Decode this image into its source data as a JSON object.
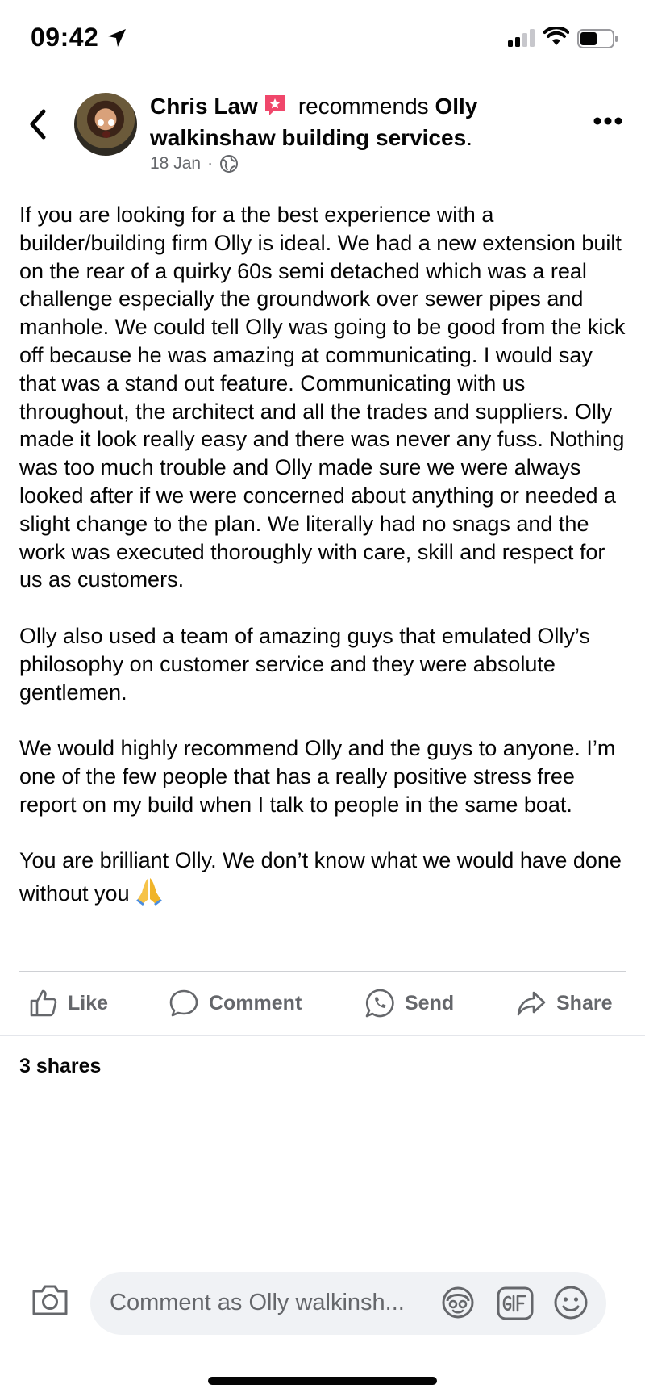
{
  "status_bar": {
    "time": "09:42"
  },
  "header": {
    "author": "Chris Law",
    "verb": "recommends",
    "page_name": "Olly walkinshaw building services",
    "punct": ".",
    "date": "18 Jan",
    "separator": "·"
  },
  "post": {
    "paragraphs": [
      "If you are looking for a the best experience with a builder/building firm Olly is ideal. We had a new extension built on the rear of a quirky 60s semi detached which was a real challenge especially the groundwork over sewer pipes and manhole. We could tell Olly was going to be good from the kick off because he was amazing at communicating. I would say that was a stand out feature. Communicating with us throughout, the architect and all the trades and suppliers. Olly made it look really easy and there was never any fuss. Nothing was too much trouble and Olly made sure we were always looked after if we were concerned about anything or needed a slight change to the plan. We literally had no snags and the work was executed thoroughly with care, skill and respect for us as customers.",
      "Olly also used a team of amazing guys that emulated Olly’s philosophy on customer service and they were absolute gentlemen.",
      "We would highly recommend Olly and the guys to anyone. I’m one of the few people that has a really positive stress free report on my build when I talk to people in the same boat.",
      "You are brilliant Olly. We don’t know what we would have done without you"
    ]
  },
  "actions": {
    "like": "Like",
    "comment": "Comment",
    "send": "Send",
    "share": "Share"
  },
  "shares_text": "3 shares",
  "comment_box": {
    "placeholder": "Comment as Olly walkinsh..."
  },
  "colors": {
    "secondary_text": "#65676b",
    "input_bg": "#f0f2f5",
    "badge": "#f0476b"
  },
  "icons": [
    "location-arrow-icon",
    "signal-icon",
    "wifi-icon",
    "battery-icon",
    "back-chevron-icon",
    "star-badge-icon",
    "globe-icon",
    "more-dots-icon",
    "praying-hands-emoji",
    "like-thumb-icon",
    "comment-bubble-icon",
    "whatsapp-send-icon",
    "share-arrow-icon",
    "camera-icon",
    "avatar-sticker-icon",
    "gif-icon",
    "emoji-smile-icon"
  ]
}
